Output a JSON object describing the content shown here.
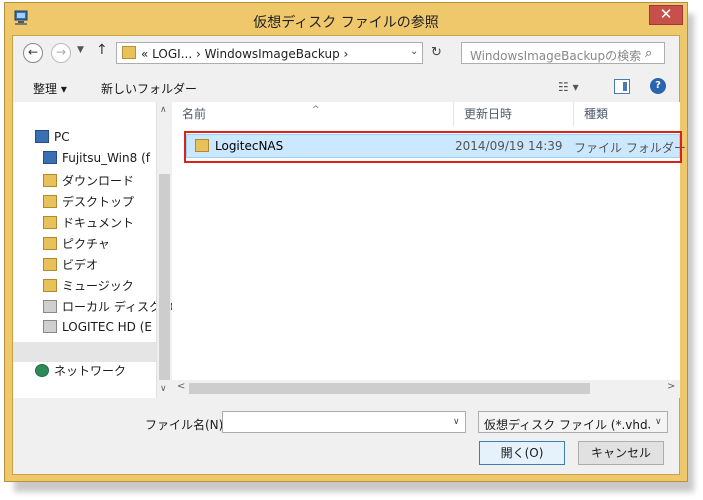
{
  "window": {
    "title": "仮想ディスク ファイルの参照",
    "close_glyph": "✕"
  },
  "address_bar": {
    "back_glyph": "←",
    "forward_glyph": "→",
    "recent_glyph": "▼",
    "up_glyph": "↑",
    "path_text": "«  LOGI...  ›  WindowsImageBackup  ›",
    "dropdown_glyph": "⌄",
    "refresh_glyph": "↻",
    "search_placeholder": "WindowsImageBackupの検索",
    "search_glyph": "⌕"
  },
  "toolbar": {
    "organize_label": "整理 ▾",
    "new_folder_label": "新しいフォルダー",
    "view_glyph": "☷ ▾",
    "help_glyph": "?"
  },
  "nav_pane": {
    "items": [
      {
        "label": "PC",
        "icon": "pc-icon"
      },
      {
        "label": "Fujitsu_Win8 (f",
        "icon": "pc-icon"
      },
      {
        "label": "ダウンロード",
        "icon": "folder-icon"
      },
      {
        "label": "デスクトップ",
        "icon": "folder-icon"
      },
      {
        "label": "ドキュメント",
        "icon": "folder-icon"
      },
      {
        "label": "ピクチャ",
        "icon": "folder-icon"
      },
      {
        "label": "ビデオ",
        "icon": "folder-icon"
      },
      {
        "label": "ミュージック",
        "icon": "folder-icon"
      },
      {
        "label": "ローカル ディスク (C",
        "icon": "drive-icon"
      },
      {
        "label": "LOGITEC HD (E",
        "icon": "drive-icon"
      },
      {
        "label": "ネットワーク",
        "icon": "network-icon"
      }
    ],
    "scroll_up_glyph": "∧",
    "scroll_down_glyph": "∨"
  },
  "file_list": {
    "columns": [
      "名前",
      "更新日時",
      "種類"
    ],
    "sort_glyph": "^",
    "rows": [
      {
        "name": "LogitecNAS",
        "modified": "2014/09/19 14:39",
        "type": "ファイル フォルダー"
      }
    ],
    "scroll_left_glyph": "<",
    "scroll_right_glyph": ">"
  },
  "bottom": {
    "filename_label": "ファイル名(N):",
    "filename_value": "",
    "filename_drop_glyph": "∨",
    "filter_value": "仮想ディスク ファイル (*.vhd、*.vh",
    "filter_drop_glyph": "∨",
    "open_label": "開く(O)",
    "cancel_label": "キャンセル"
  },
  "colors": {
    "frame": "#f0c86c",
    "close_button": "#c7504a",
    "selection": "#cce8ff",
    "highlight_box": "#d8231c"
  }
}
